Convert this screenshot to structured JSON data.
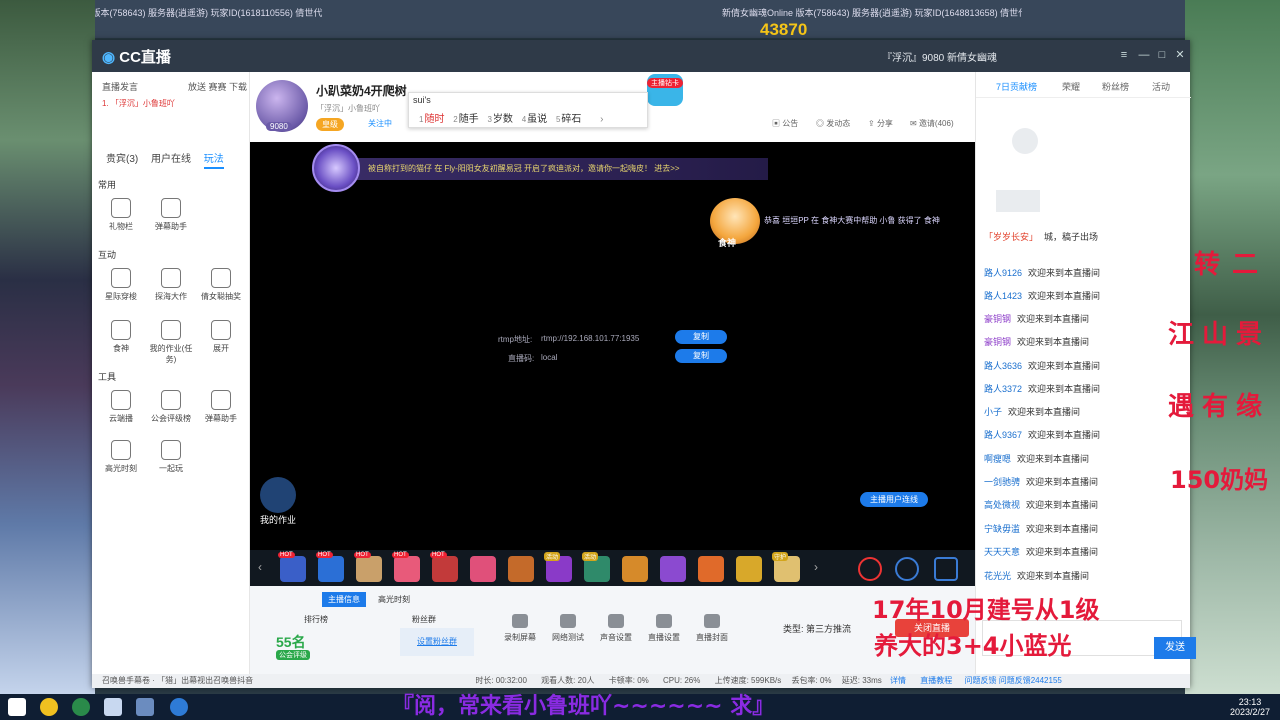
{
  "background": {
    "left_window_title": "新倩女幽魂Online 版本(758643) 服务器(逍遥游) 玩家ID(1618110556) 倩世代",
    "right_window_title": "新倩女幽魂Online 版本(758643) 服务器(逍遥游) 玩家ID(1648813658) 倩世代",
    "score": "43870"
  },
  "app": {
    "logo": "CC直播",
    "room_title": "『浮沉』9080 新倩女幽魂",
    "room_title_id": "9080"
  },
  "left_panel": {
    "header": "直播发言",
    "header_right": "放送 赛赛 下载",
    "first_item": "1. 「浮沉」小鲁班吖",
    "tabs": [
      "贵宾(3)",
      "用户在线",
      "玩法"
    ],
    "sections": [
      {
        "title": "常用",
        "tools": [
          "礼物栏",
          "弹幕助手"
        ]
      },
      {
        "title": "互动",
        "tools": [
          "星际穿梭",
          "探海大作",
          "倩女聪抽奖",
          "食神",
          "我的作业(任务)",
          "展开"
        ]
      },
      {
        "title": "工具",
        "tools": [
          "云端播",
          "公会评级榜",
          "弹幕助手",
          "高光时刻",
          "一起玩"
        ]
      }
    ]
  },
  "header": {
    "avatar_num": "9080",
    "room_name": "小趴菜奶4开爬树",
    "sub": "「浮沉」小鲁班吖",
    "level": "皇级",
    "follow": "关注中",
    "tools": [
      "公告",
      "发动态",
      "分享",
      "邀请(406)"
    ]
  },
  "search_popup": {
    "query": "sui's",
    "candidates": [
      {
        "n": "1",
        "text": "随时"
      },
      {
        "n": "2",
        "text": "随手"
      },
      {
        "n": "3",
        "text": "岁数"
      },
      {
        "n": "4",
        "text": "虽说"
      },
      {
        "n": "5",
        "text": "碎石"
      }
    ],
    "next": "›"
  },
  "host_badge": "主播钻卡",
  "video": {
    "banner": "被自称打到的猫仔 在 Fly-阳阳女友初醒易冠 开启了疯迪派对，邀请你一起嗨皮！ 进去>>",
    "god_label": "食神",
    "god_msg": "恭喜 垣垣PP 在 食神大赛中帮助 小鲁 获得了 食神",
    "rtmp_label": "rtmp地址:",
    "rtmp_value": "rtmp://192.168.101.77:1935",
    "key_label": "直播码:",
    "key_value": "local",
    "copy_btn": "复制",
    "switch_btn": "主播用户连线",
    "mywork": "我的作业"
  },
  "gifts": {
    "hot_tag": "HOT",
    "event_tag": "活动",
    "guard_tag": "守护"
  },
  "bottom": {
    "tabs": [
      "主播信息",
      "高光时刻"
    ],
    "rank_label": "排行榜",
    "fans_label": "粉丝群",
    "rank_value": "55名",
    "guild": "公会评级",
    "setup_fans": "设置粉丝群",
    "controls": [
      "录制屏幕",
      "网络测试",
      "声音设置",
      "直播设置",
      "直播封面"
    ],
    "type_label": "类型: 第三方推流",
    "close_live": "关闭直播"
  },
  "status_bar": {
    "left": "召唤兽手幕卷 · 「猎」出幕视出召唤兽抖音",
    "time": "时长: 00:32:00",
    "viewers": "观看人数: 20人",
    "drop": "卡顿率: 0%",
    "cpu": "CPU: 26%",
    "upload": "上传速度: 599KB/s",
    "loss": "丢包率: 0%",
    "delay": "延迟: 33ms",
    "detail": "详情",
    "help": "直播教程",
    "feedback": "问题反馈 问题反馈2442155"
  },
  "right_panel": {
    "tabs": [
      "7日贡献榜",
      "荣耀",
      "粉丝榜",
      "活动"
    ],
    "chat": [
      {
        "u": "「岁岁长安」",
        "m": "城，稿子出场"
      },
      {
        "u": "路人9126",
        "m": "欢迎来到本直播间"
      },
      {
        "u": "路人1423",
        "m": "欢迎来到本直播间"
      },
      {
        "u": "豪铜钢",
        "m": "欢迎来到本直播间"
      },
      {
        "u": "豪铜钢",
        "m": "欢迎来到本直播间"
      },
      {
        "u": "路人3636",
        "m": "欢迎来到本直播间"
      },
      {
        "u": "路人3372",
        "m": "欢迎来到本直播间"
      },
      {
        "u": "小子",
        "m": "欢迎来到本直播间"
      },
      {
        "u": "路人9367",
        "m": "欢迎来到本直播间"
      },
      {
        "u": "啊瘦嗯",
        "m": "欢迎来到本直播间"
      },
      {
        "u": "一剑驰骋",
        "m": "欢迎来到本直播间"
      },
      {
        "u": "高处微视",
        "m": "欢迎来到本直播间"
      },
      {
        "u": "宁缺毋滥",
        "m": "欢迎来到本直播间"
      },
      {
        "u": "天天天意",
        "m": "欢迎来到本直播间"
      },
      {
        "u": "花光光",
        "m": "欢迎来到本直播间"
      }
    ],
    "send_btn": "发送"
  },
  "overlays": {
    "side_1": "转二",
    "side_2": "江山景",
    "side_3": "遇有缘",
    "side_4": "150奶妈",
    "bottom_1": "17年10月建号从1级",
    "bottom_2": "养大的3+4小蓝光",
    "footer": "『阅，常来看小鲁班吖~~~~~~      求』"
  },
  "taskbar": {
    "time": "23:13",
    "date": "2023/2/27"
  },
  "colors": {
    "accent": "#1d7bea",
    "overlay_red": "#e41a3b",
    "footer_purple": "#8a2be2"
  }
}
